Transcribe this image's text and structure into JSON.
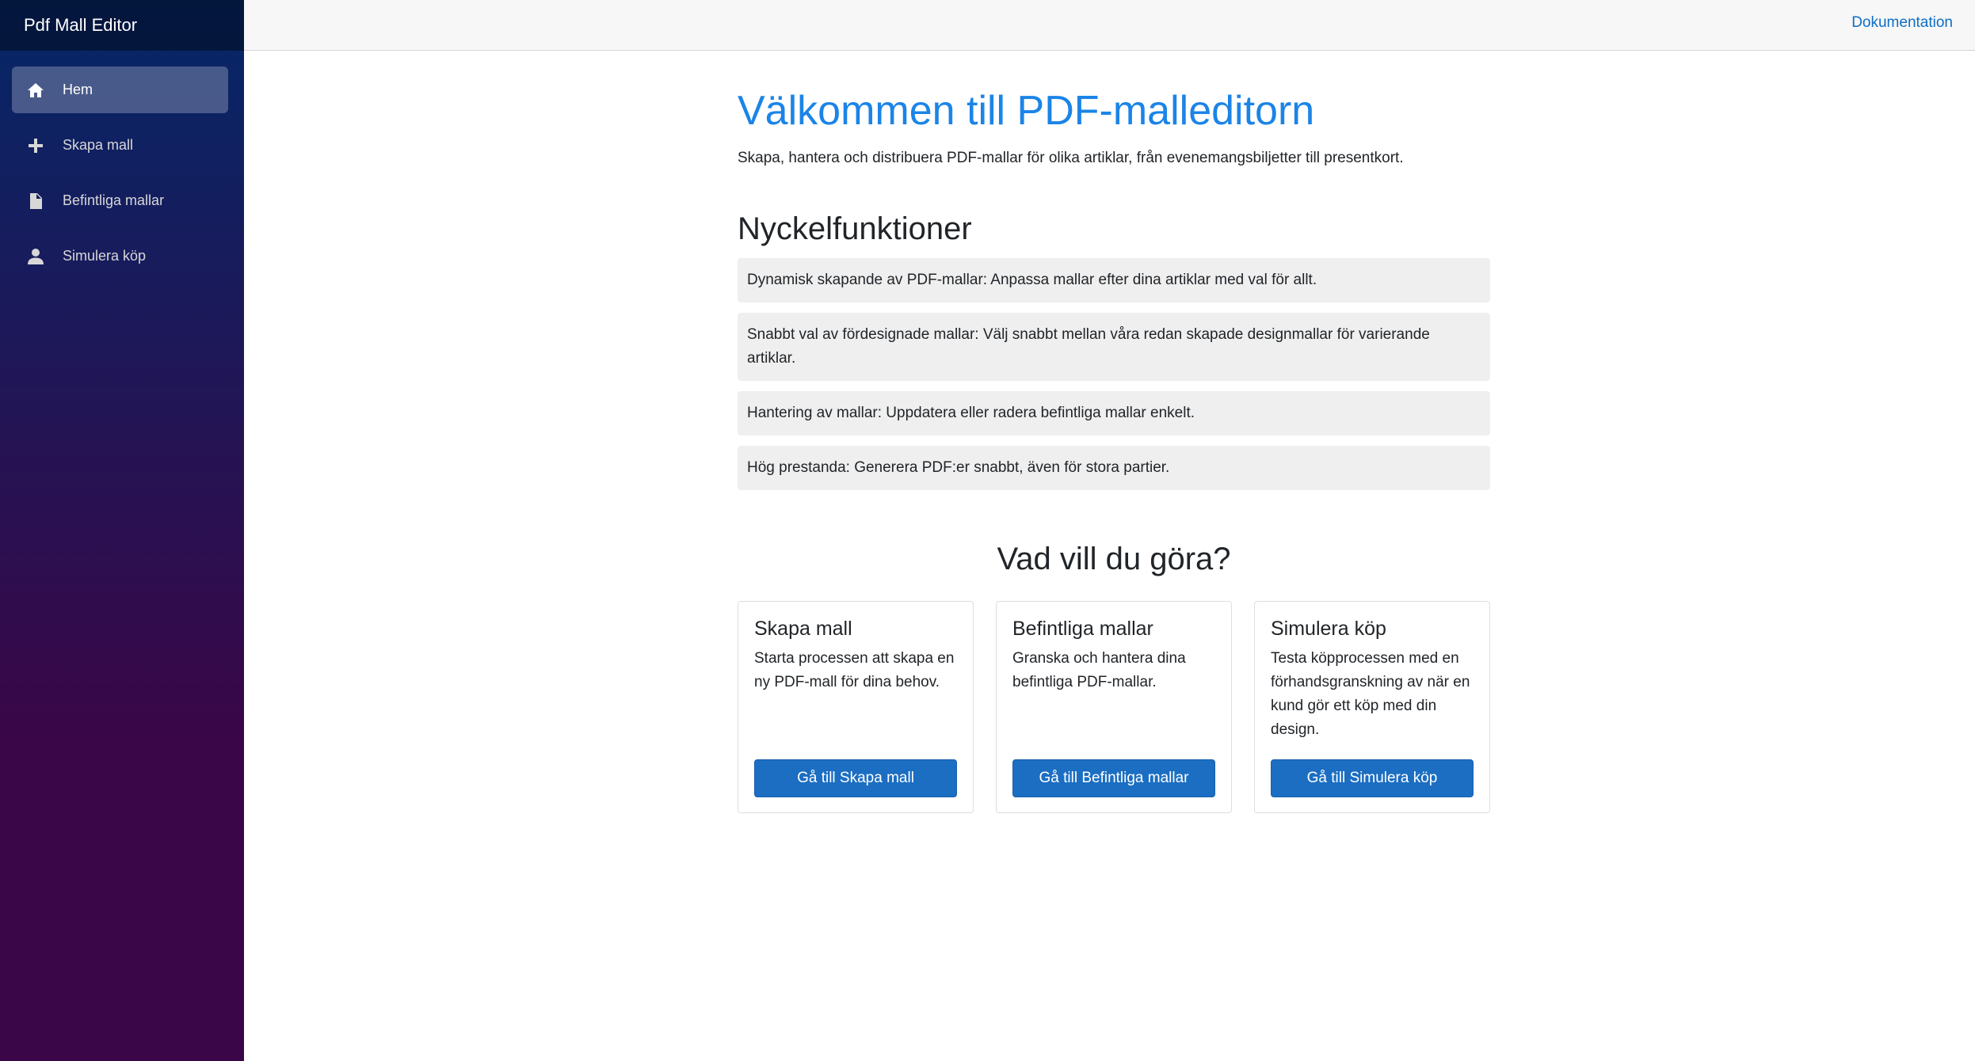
{
  "app": {
    "title": "Pdf Mall Editor"
  },
  "sidebar": {
    "items": [
      {
        "label": "Hem",
        "icon": "home-icon",
        "active": true
      },
      {
        "label": "Skapa mall",
        "icon": "plus-icon",
        "active": false
      },
      {
        "label": "Befintliga mallar",
        "icon": "document-icon",
        "active": false
      },
      {
        "label": "Simulera köp",
        "icon": "person-icon",
        "active": false
      }
    ]
  },
  "topbar": {
    "doc_link": "Dokumentation"
  },
  "main": {
    "title": "Välkommen till PDF-malleditorn",
    "intro": "Skapa, hantera och distribuera PDF-mallar för olika artiklar, från evenemangsbiljetter till presentkort.",
    "features_heading": "Nyckelfunktioner",
    "features": [
      "Dynamisk skapande av PDF-mallar: Anpassa mallar efter dina artiklar med val för allt.",
      "Snabbt val av fördesignade mallar: Välj snabbt mellan våra redan skapade designmallar för varierande artiklar.",
      "Hantering av mallar: Uppdatera eller radera befintliga mallar enkelt.",
      "Hög prestanda: Generera PDF:er snabbt, även för stora partier."
    ],
    "cta_heading": "Vad vill du göra?",
    "cards": [
      {
        "title": "Skapa mall",
        "text": "Starta processen att skapa en ny PDF-mall för dina behov.",
        "button": "Gå till Skapa mall"
      },
      {
        "title": "Befintliga mallar",
        "text": "Granska och hantera dina befintliga PDF-mallar.",
        "button": "Gå till Befintliga mallar"
      },
      {
        "title": "Simulera köp",
        "text": "Testa köpprocessen med en förhandsgranskning av när en kund gör ett köp med din design.",
        "button": "Gå till Simulera köp"
      }
    ]
  },
  "colors": {
    "accent": "#1b84e7",
    "button": "#1b6ec2",
    "link": "#0d6ec4",
    "sidebar_top": "#052767",
    "sidebar_bottom": "#3a0647"
  }
}
